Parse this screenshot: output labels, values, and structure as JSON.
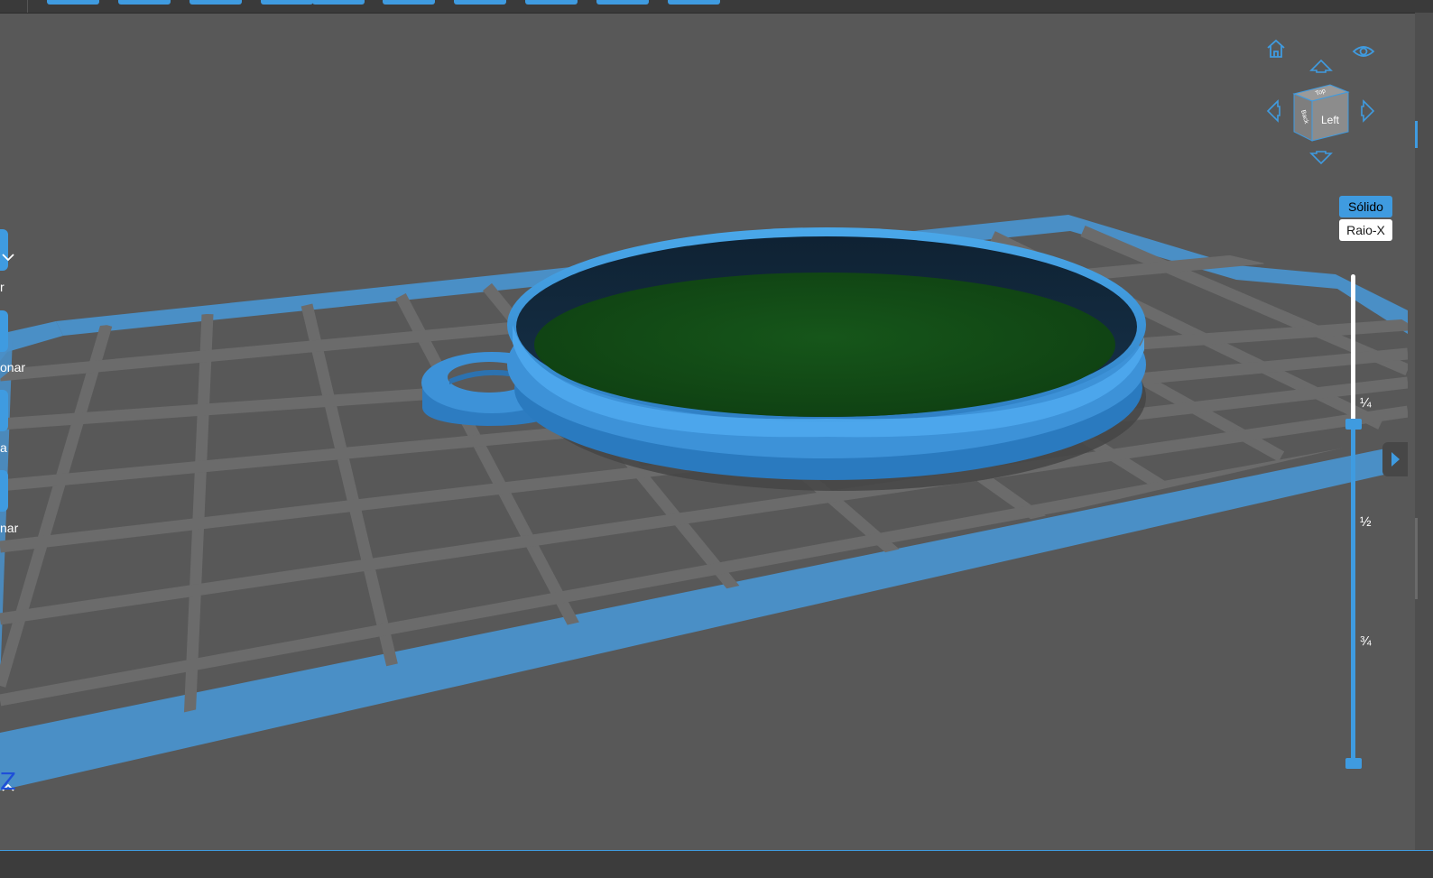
{
  "left_toolbar": {
    "items": [
      {
        "label_fragment": "r"
      },
      {
        "label_fragment": "onar"
      },
      {
        "label_fragment": "a"
      },
      {
        "label_fragment": "nar"
      }
    ]
  },
  "view_controls": {
    "cube_faces": {
      "front": "Left",
      "side": "Back",
      "top": "Top"
    },
    "icons": [
      "home-icon",
      "eye-icon",
      "arrow-up-icon",
      "arrow-down-icon",
      "arrow-left-icon",
      "arrow-right-icon"
    ]
  },
  "render_modes": {
    "solid": "Sólido",
    "xray": "Raio-X",
    "active": "solid"
  },
  "layer_slider": {
    "ticks": [
      "¼",
      "½",
      "¾"
    ],
    "upper_handle_fraction": 0.23,
    "lower_handle_fraction": 1.0
  },
  "axis": {
    "z_label": "Z"
  },
  "colors": {
    "accent": "#3f9be0",
    "model_blue": "#3d8fd6",
    "resin_green": "#155214",
    "background": "#585858",
    "grid": "#6c6c6c",
    "plate_border": "#4a90c8"
  }
}
